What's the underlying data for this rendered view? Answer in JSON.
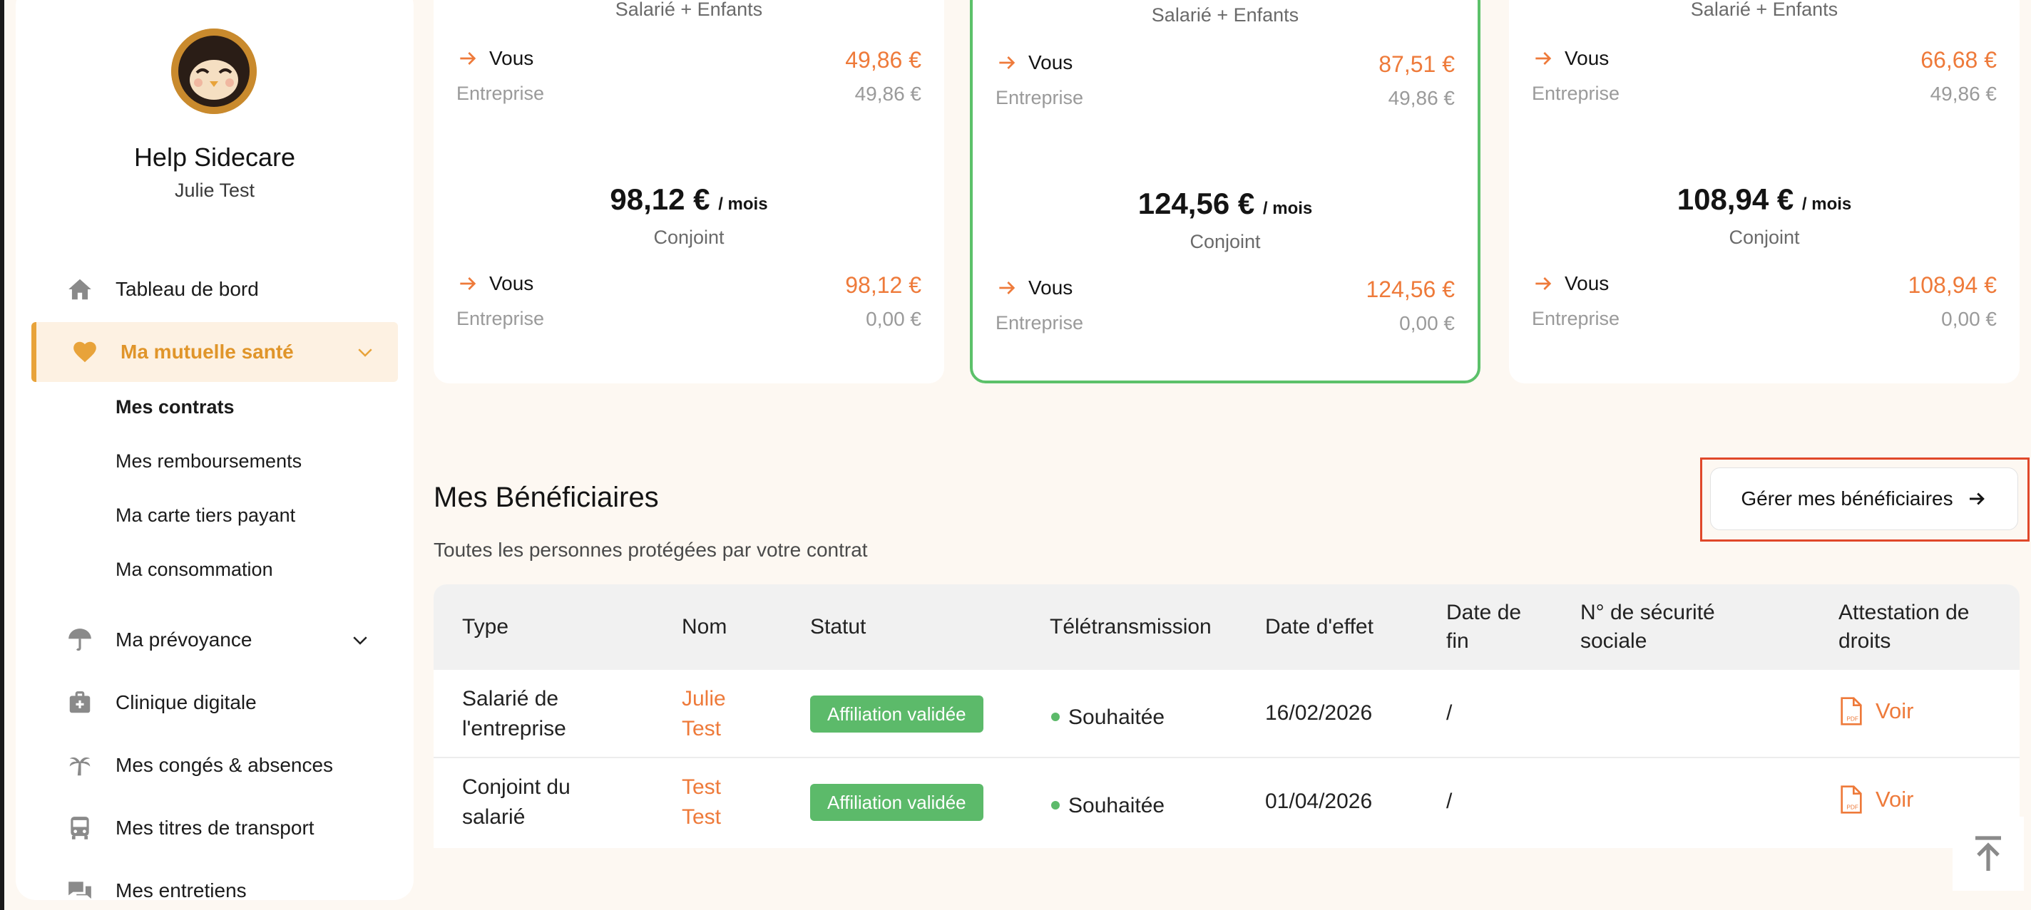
{
  "sidebar": {
    "brand": "Help Sidecare",
    "user": "Julie Test",
    "nav": [
      {
        "label": "Tableau de bord",
        "icon": "home-icon"
      },
      {
        "label": "Ma mutuelle santé",
        "icon": "heart-icon"
      },
      {
        "label": "Ma prévoyance",
        "icon": "umbrella-icon"
      },
      {
        "label": "Clinique digitale",
        "icon": "medical-kit-icon"
      },
      {
        "label": "Mes congés & absences",
        "icon": "palm-tree-icon"
      },
      {
        "label": "Mes titres de transport",
        "icon": "bus-icon"
      },
      {
        "label": "Mes entretiens",
        "icon": "chat-bubbles-icon"
      }
    ],
    "sub_items": [
      "Mes contrats",
      "Mes remboursements",
      "Ma carte tiers payant",
      "Ma consommation"
    ]
  },
  "plans": [
    {
      "head": "Salarié + Enfants",
      "top_vous": "49,86 €",
      "top_entreprise": "49,86 €",
      "total": "98,12 €",
      "per": "/ mois",
      "subject": "Conjoint",
      "bottom_vous": "98,12 €",
      "bottom_entreprise": "0,00 €"
    },
    {
      "head": "Salarié + Enfants",
      "top_vous": "87,51 €",
      "top_entreprise": "49,86 €",
      "total": "124,56 €",
      "per": "/ mois",
      "subject": "Conjoint",
      "bottom_vous": "124,56 €",
      "bottom_entreprise": "0,00 €"
    },
    {
      "head": "Salarié + Enfants",
      "top_vous": "66,68 €",
      "top_entreprise": "49,86 €",
      "total": "108,94 €",
      "per": "/ mois",
      "subject": "Conjoint",
      "bottom_vous": "108,94 €",
      "bottom_entreprise": "0,00 €"
    }
  ],
  "labels": {
    "vous": "Vous",
    "entreprise": "Entreprise"
  },
  "beneficiaires": {
    "title": "Mes Bénéficiaires",
    "subtitle": "Toutes les personnes protégées par votre contrat",
    "manage_button": "Gérer mes bénéficiaires",
    "columns": [
      "Type",
      "Nom",
      "Statut",
      "Télétransmission",
      "Date d'effet",
      "Date de fin",
      "N° de sécurité sociale",
      "Attestation de droits"
    ],
    "rows": [
      {
        "type": "Salarié de l'entreprise",
        "nom": "Julie Test",
        "statut": "Affiliation validée",
        "teletransmission": "Souhaitée",
        "date_effet": "16/02/2026",
        "date_fin": "/",
        "secu": "",
        "attestation": "Voir"
      },
      {
        "type": "Conjoint du salarié",
        "nom": "Test Test",
        "statut": "Affiliation validée",
        "teletransmission": "Souhaitée",
        "date_effet": "01/04/2026",
        "date_fin": "/",
        "secu": "",
        "attestation": "Voir"
      }
    ]
  },
  "colors": {
    "accent": "#ee7a3a",
    "active_nav": "#e8a33a",
    "success": "#5cba6a",
    "highlight": "#e0482a",
    "background": "#fdf8f2"
  }
}
